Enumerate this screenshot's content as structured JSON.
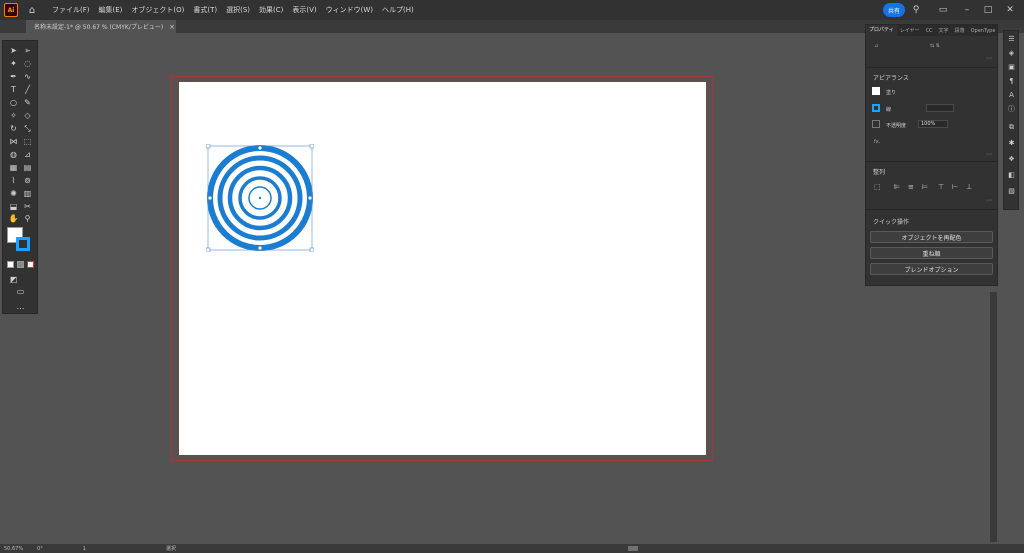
{
  "menubar": {
    "logo": "Ai",
    "items": [
      "ファイル(F)",
      "編集(E)",
      "オブジェクト(O)",
      "書式(T)",
      "選択(S)",
      "効果(C)",
      "表示(V)",
      "ウィンドウ(W)",
      "ヘルプ(H)"
    ],
    "share_label": "共有"
  },
  "document": {
    "tab_title": "名称未設定-1* @ 50.67 % (CMYK/プレビュー)",
    "close": "×"
  },
  "panel": {
    "tabs": [
      "プロパティ",
      "レイヤー",
      "CC",
      "文字",
      "段落",
      "OpenType"
    ],
    "appearance_title": "アピアランス",
    "fill_label": "塗り",
    "stroke_label": "線",
    "opacity_label": "不透明度",
    "opacity_value": "100%",
    "align_title": "整列",
    "quick_actions_title": "クイック操作",
    "btn_recolor": "オブジェクトを再配色",
    "btn_group": "重ね順",
    "btn_blend": "ブレンドオプション"
  },
  "status": {
    "zoom": "50.67%",
    "rotation": "0°",
    "artboard": "1",
    "mode": "選択"
  },
  "colors": {
    "accent": "#1473e6",
    "target_blue": "#1a7dd1",
    "stroke_swatch": "#1aa3ff"
  }
}
